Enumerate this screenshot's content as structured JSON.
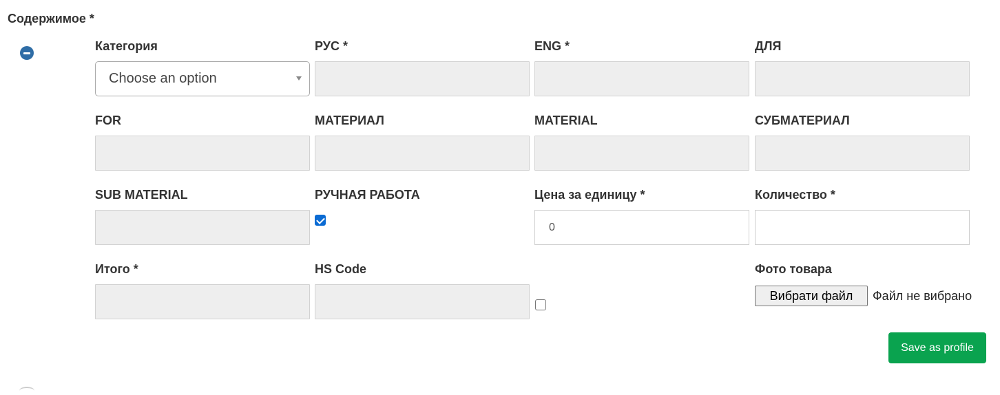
{
  "section": {
    "title": "Содержимое *"
  },
  "colors": {
    "accent": "#2f6da6",
    "save": "#0aa34f",
    "checkbox": "#0b6bd3"
  },
  "fields": {
    "category": {
      "label": "Категория",
      "value": "Choose an option"
    },
    "rus": {
      "label": "РУС *"
    },
    "eng": {
      "label": "ENG *"
    },
    "dlya": {
      "label": "ДЛЯ"
    },
    "for": {
      "label": "FOR"
    },
    "material_ru": {
      "label": "МАТЕРИАЛ"
    },
    "material_en": {
      "label": "MATERIAL"
    },
    "submaterial_ru": {
      "label": "СУБМАТЕРИАЛ"
    },
    "submaterial_en": {
      "label": "SUB MATERIAL"
    },
    "handmade": {
      "label": "РУЧНАЯ РАБОТА",
      "checked": true
    },
    "unit_price": {
      "label": "Цена за единицу *",
      "value": "0"
    },
    "quantity": {
      "label": "Количество *",
      "value": ""
    },
    "total": {
      "label": "Итого *"
    },
    "hs_code": {
      "label": "HS Code"
    },
    "extra_checkbox": {
      "checked": false
    },
    "photo": {
      "label": "Фото товара",
      "button": "Вибрати файл",
      "status": "Файл не вибрано"
    }
  },
  "actions": {
    "save_profile": "Save as profile"
  }
}
